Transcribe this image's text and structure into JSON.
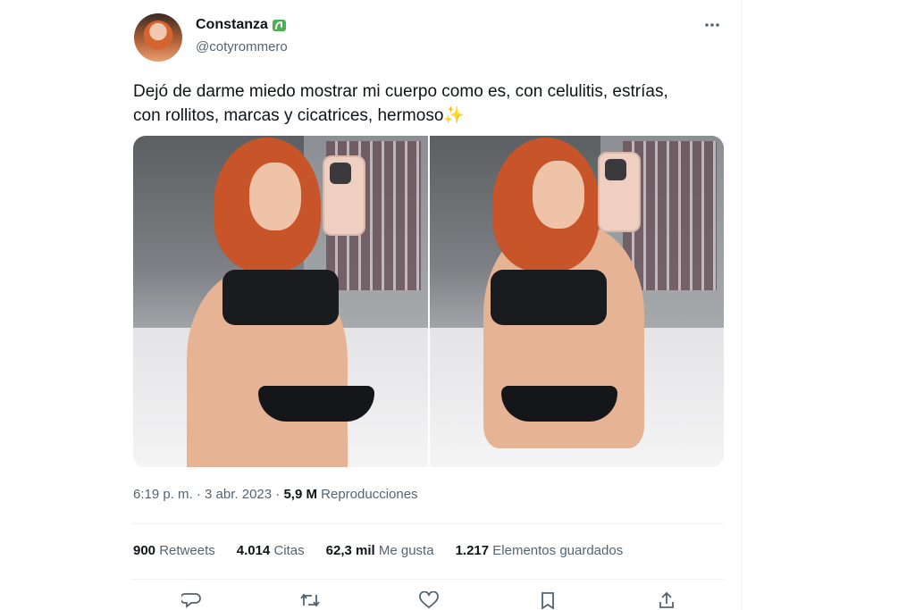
{
  "user": {
    "display_name": "Constanza",
    "handle": "@cotyrommero",
    "name_emoji": "seedling-emoji"
  },
  "more_icon": "more-horizontal-icon",
  "tweet": {
    "text_line1": "Dejó de darme miedo mostrar mi cuerpo como es, con celulitis, estrías,",
    "text_line2": "con rollitos, marcas y cicatrices, hermoso",
    "text_emoji": "✨"
  },
  "media": [
    {
      "description_icon": "photo-1"
    },
    {
      "description_icon": "photo-2"
    }
  ],
  "meta": {
    "time": "6:19 p. m.",
    "separator": " · ",
    "date": "3 abr. 2023",
    "views_value": "5,9 M",
    "views_label": "Reproducciones"
  },
  "stats": {
    "retweets_value": "900",
    "retweets_label": "Retweets",
    "quotes_value": "4.014",
    "quotes_label": "Citas",
    "likes_value": "62,3 mil",
    "likes_label": "Me gusta",
    "bookmarks_value": "1.217",
    "bookmarks_label": "Elementos guardados"
  },
  "actions": [
    "reply-icon",
    "retweet-icon",
    "like-icon",
    "bookmark-icon",
    "share-icon"
  ],
  "colors": {
    "text_primary": "#0f1419",
    "text_secondary": "#536471",
    "divider": "#eff3f4",
    "emoji_green": "#4caf50",
    "sparkle": "#f4c430"
  }
}
